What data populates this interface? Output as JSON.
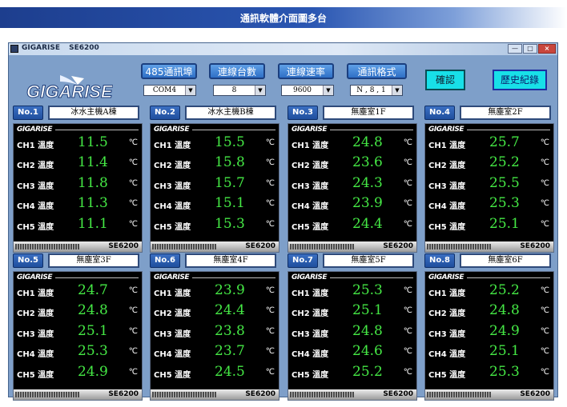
{
  "banner": {
    "title": "通訊軟體介面圖多台"
  },
  "window": {
    "title_brand": "GIGARISE",
    "title_model": "SE6200",
    "logo_text": "GIGARISE",
    "controls": {
      "minimize": "—",
      "maximize": "□",
      "close": "×"
    }
  },
  "toolbar": {
    "comport_label": "485通訊埠",
    "count_label": "連線台數",
    "baud_label": "連線速率",
    "format_label": "通訊格式",
    "comport_value": "COM4",
    "count_value": "8",
    "baud_value": "9600",
    "format_value": "N , 8 , 1",
    "dropdown_arrow": "▼",
    "confirm_label": "確認",
    "history_label": "歷史紀錄"
  },
  "units": {
    "temp": "℃"
  },
  "panels": [
    {
      "no": "No.1",
      "name": "冰水主機A棟",
      "model": "SE6200",
      "channels": [
        {
          "ch": "CH1",
          "label": "溫度",
          "value": "11.5"
        },
        {
          "ch": "CH2",
          "label": "溫度",
          "value": "11.4"
        },
        {
          "ch": "CH3",
          "label": "溫度",
          "value": "11.8"
        },
        {
          "ch": "CH4",
          "label": "溫度",
          "value": "11.3"
        },
        {
          "ch": "CH5",
          "label": "溫度",
          "value": "11.1"
        }
      ]
    },
    {
      "no": "No.2",
      "name": "冰水主機B棟",
      "model": "SE6200",
      "channels": [
        {
          "ch": "CH1",
          "label": "溫度",
          "value": "15.5"
        },
        {
          "ch": "CH2",
          "label": "溫度",
          "value": "15.8"
        },
        {
          "ch": "CH3",
          "label": "溫度",
          "value": "15.7"
        },
        {
          "ch": "CH4",
          "label": "溫度",
          "value": "15.1"
        },
        {
          "ch": "CH5",
          "label": "溫度",
          "value": "15.3"
        }
      ]
    },
    {
      "no": "No.3",
      "name": "無塵室1F",
      "model": "SE6200",
      "channels": [
        {
          "ch": "CH1",
          "label": "溫度",
          "value": "24.8"
        },
        {
          "ch": "CH2",
          "label": "溫度",
          "value": "23.6"
        },
        {
          "ch": "CH3",
          "label": "溫度",
          "value": "24.3"
        },
        {
          "ch": "CH4",
          "label": "溫度",
          "value": "23.9"
        },
        {
          "ch": "CH5",
          "label": "溫度",
          "value": "24.4"
        }
      ]
    },
    {
      "no": "No.4",
      "name": "無塵室2F",
      "model": "SE6200",
      "channels": [
        {
          "ch": "CH1",
          "label": "溫度",
          "value": "25.7"
        },
        {
          "ch": "CH2",
          "label": "溫度",
          "value": "25.2"
        },
        {
          "ch": "CH3",
          "label": "溫度",
          "value": "25.5"
        },
        {
          "ch": "CH4",
          "label": "溫度",
          "value": "25.3"
        },
        {
          "ch": "CH5",
          "label": "溫度",
          "value": "25.1"
        }
      ]
    },
    {
      "no": "No.5",
      "name": "無塵室3F",
      "model": "SE6200",
      "channels": [
        {
          "ch": "CH1",
          "label": "溫度",
          "value": "24.7"
        },
        {
          "ch": "CH2",
          "label": "溫度",
          "value": "24.8"
        },
        {
          "ch": "CH3",
          "label": "溫度",
          "value": "25.1"
        },
        {
          "ch": "CH4",
          "label": "溫度",
          "value": "25.3"
        },
        {
          "ch": "CH5",
          "label": "溫度",
          "value": "24.9"
        }
      ]
    },
    {
      "no": "No.6",
      "name": "無塵室4F",
      "model": "SE6200",
      "channels": [
        {
          "ch": "CH1",
          "label": "溫度",
          "value": "23.9"
        },
        {
          "ch": "CH2",
          "label": "溫度",
          "value": "24.4"
        },
        {
          "ch": "CH3",
          "label": "溫度",
          "value": "23.8"
        },
        {
          "ch": "CH4",
          "label": "溫度",
          "value": "23.7"
        },
        {
          "ch": "CH5",
          "label": "溫度",
          "value": "24.5"
        }
      ]
    },
    {
      "no": "No.7",
      "name": "無塵室5F",
      "model": "SE6200",
      "channels": [
        {
          "ch": "CH1",
          "label": "溫度",
          "value": "25.3"
        },
        {
          "ch": "CH2",
          "label": "溫度",
          "value": "25.1"
        },
        {
          "ch": "CH3",
          "label": "溫度",
          "value": "24.8"
        },
        {
          "ch": "CH4",
          "label": "溫度",
          "value": "24.6"
        },
        {
          "ch": "CH5",
          "label": "溫度",
          "value": "25.2"
        }
      ]
    },
    {
      "no": "No.8",
      "name": "無塵室6F",
      "model": "SE6200",
      "channels": [
        {
          "ch": "CH1",
          "label": "溫度",
          "value": "25.2"
        },
        {
          "ch": "CH2",
          "label": "溫度",
          "value": "24.8"
        },
        {
          "ch": "CH3",
          "label": "溫度",
          "value": "24.9"
        },
        {
          "ch": "CH4",
          "label": "溫度",
          "value": "25.1"
        },
        {
          "ch": "CH5",
          "label": "溫度",
          "value": "25.3"
        }
      ]
    }
  ]
}
